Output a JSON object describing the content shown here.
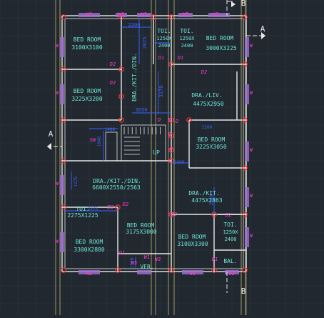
{
  "colors": {
    "background": "#212830",
    "grid": "#2c343e",
    "wall": "#e8e8e8",
    "axis_line": "#d8c878",
    "room_text": "#6ee8d8",
    "door_tag": "#ff3cc8",
    "window_tag": "#ff3cc8",
    "dimension": "#3c64ff",
    "window_fill": "#9a6cc8",
    "column": "#ff3030",
    "section_mark": "#e8e8e8"
  },
  "section_marks": {
    "a_left": "A",
    "a_right": "A",
    "b_top": "B",
    "b_bottom": "B"
  },
  "rooms": [
    {
      "id": "bed1",
      "name": "BED ROOM",
      "size": "3100X3100"
    },
    {
      "id": "toi1",
      "name": "TOI.",
      "size": "1250X",
      "size2": "2400"
    },
    {
      "id": "toi2",
      "name": "TOI.",
      "size": "1250X",
      "size2": "2400"
    },
    {
      "id": "bed2",
      "name": "BED ROOM",
      "size": "3000X3225"
    },
    {
      "id": "bed3",
      "name": "BED ROOM",
      "size": "3225X3200"
    },
    {
      "id": "drakit1",
      "name": "DRA./KIT./DIN."
    },
    {
      "id": "dra_liv",
      "name": "DRA./LIV.",
      "size": "4475X2950"
    },
    {
      "id": "bed4",
      "name": "BED ROOM",
      "size": "3225X3050"
    },
    {
      "id": "drakit2",
      "name": "DRA./KIT./DIN.",
      "size": "6600X2550/2563"
    },
    {
      "id": "drakit3",
      "name": "DRA./KIT.",
      "size": "4475X2863"
    },
    {
      "id": "toi3",
      "name": "TOI.",
      "size": "2275X1225"
    },
    {
      "id": "bed5",
      "name": "BED ROOM",
      "size": "3175X3000"
    },
    {
      "id": "bed6",
      "name": "BED ROOM",
      "size": "3300X2880"
    },
    {
      "id": "bed7",
      "name": "BED ROOM",
      "size": "3100X3300"
    },
    {
      "id": "toi4",
      "name": "TOI.",
      "size": "1250X",
      "size2": "2400"
    },
    {
      "id": "ver",
      "name": "VER."
    },
    {
      "id": "bal",
      "name": "BAL."
    }
  ],
  "tags": {
    "door_d1": "D1",
    "door_d2": "D2",
    "door_d": "D",
    "window_w": "W",
    "window_w1": "W1",
    "window_w2": "W2",
    "window_w3": "W3",
    "window_w5": "W5",
    "window_sw": "SW",
    "up_label": "UP"
  },
  "dimensions": {
    "d1": "2200",
    "d2": "2025",
    "d3": "3170",
    "d4": "3050",
    "d5": "1480",
    "d6": "1048",
    "d7": "1000",
    "d8": "1275",
    "d9": "2375",
    "d10": "3000",
    "d11": "1500",
    "d12": "2200"
  }
}
